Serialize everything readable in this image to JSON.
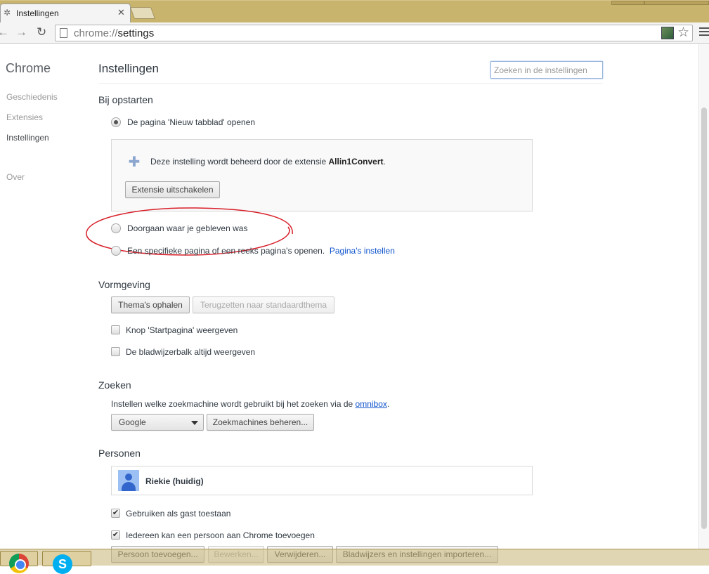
{
  "tab": {
    "title": "Instellingen",
    "close_glyph": "✕"
  },
  "toolbar": {
    "url_scheme": "chrome://",
    "url_path": "settings"
  },
  "sidebar": {
    "title": "Chrome",
    "items": [
      {
        "label": "Geschiedenis",
        "selected": false
      },
      {
        "label": "Extensies",
        "selected": false
      },
      {
        "label": "Instellingen",
        "selected": true
      },
      {
        "label": "Over",
        "selected": false
      }
    ]
  },
  "main": {
    "title": "Instellingen",
    "search_placeholder": "Zoeken in de instellingen"
  },
  "startup": {
    "heading": "Bij opstarten",
    "option_newtab": "De pagina 'Nieuw tabblad' openen",
    "extension_notice_prefix": "Deze instelling wordt beheerd door de extensie ",
    "extension_name": "Allin1Convert",
    "extension_notice_suffix": ".",
    "disable_extension_button": "Extensie uitschakelen",
    "option_continue": "Doorgaan waar je gebleven was",
    "option_specific": "Een specifieke pagina of een reeks pagina's openen.",
    "set_pages_link": "Pagina's instellen"
  },
  "appearance": {
    "heading": "Vormgeving",
    "get_themes_button": "Thema's ophalen",
    "reset_theme_button": "Terugzetten naar standaardthema",
    "show_home_button": "Knop 'Startpagina' weergeven",
    "show_bookmarks_bar": "De bladwijzerbalk altijd weergeven"
  },
  "search": {
    "heading": "Zoeken",
    "description_prefix": "Instellen welke zoekmachine wordt gebruikt bij het zoeken via de ",
    "omnibox_link": "omnibox",
    "description_suffix": ".",
    "engine_selected": "Google",
    "manage_engines_button": "Zoekmachines beheren..."
  },
  "people": {
    "heading": "Personen",
    "current_person": "Riekie (huidig)",
    "allow_guest": "Gebruiken als gast toestaan",
    "allow_add_person": "Iedereen kan een persoon aan Chrome toevoegen",
    "buttons": [
      "Persoon toevoegen...",
      "Bewerken...",
      "Verwijderen...",
      "Bladwijzers en instellingen importeren..."
    ]
  },
  "colors": {
    "link": "#1155cc",
    "annotation": "#d8202a",
    "taskbar": "#c6b476"
  },
  "icons": [
    "gear-icon",
    "back-icon",
    "forward-icon",
    "reload-icon",
    "page-icon",
    "star-icon",
    "menu-icon",
    "puzzle-icon",
    "chrome-icon",
    "skype-icon"
  ]
}
